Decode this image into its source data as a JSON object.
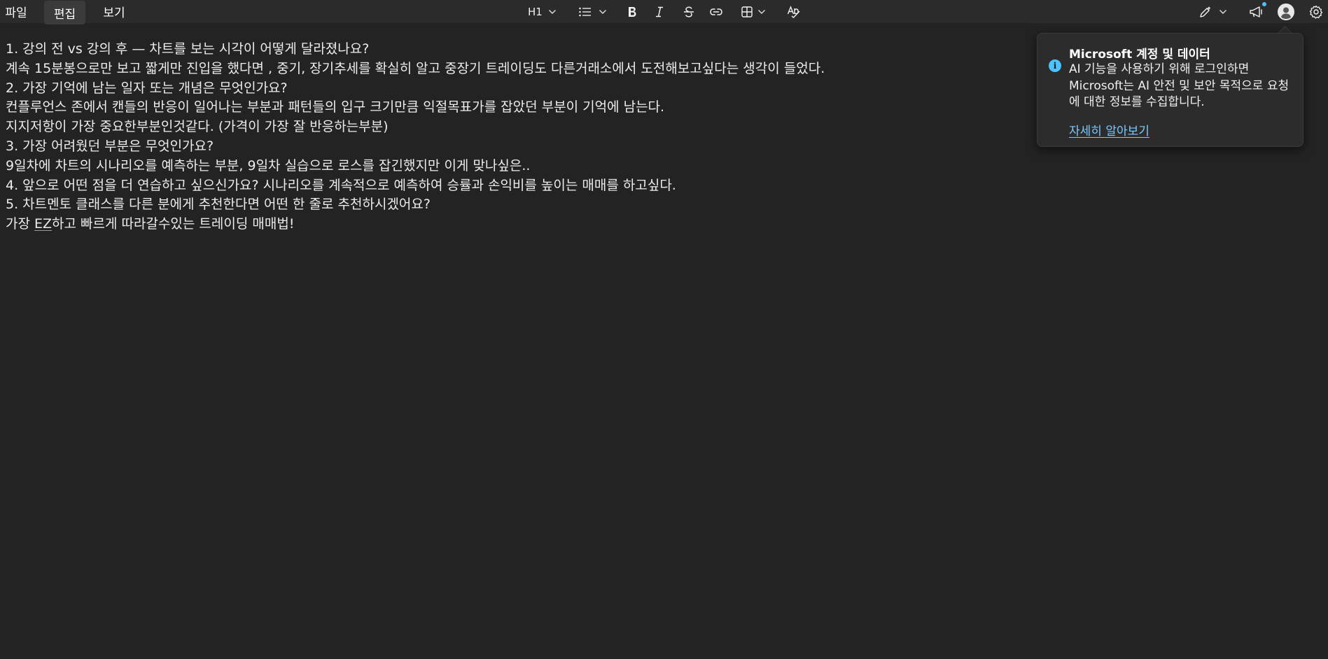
{
  "menu": {
    "file": "파일",
    "edit": "편집",
    "view": "보기"
  },
  "toolbar": {
    "heading_label": "H1",
    "icons": [
      "list-icon",
      "bold-icon",
      "italic-icon",
      "strikethrough-icon",
      "link-icon",
      "table-icon",
      "spellcheck-icon",
      "copilot-pen-icon",
      "announcement-icon",
      "account-avatar-icon",
      "settings-icon"
    ]
  },
  "document": {
    "lines": [
      "1. 강의 전 vs 강의 후 — 차트를 보는 시각이 어떻게 달라졌나요?",
      "계속 15분봉으로만 보고 짧게만 진입을 했다면 , 중기, 장기추세를 확실히 알고 중장기 트레이딩도 다른거래소에서 도전해보고싶다는 생각이 들었다.",
      "2. 가장 기억에 남는 일자 또는 개념은 무엇인가요?",
      "컨플루언스 존에서 캔들의 반응이 일어나는 부분과 패턴들의 입구 크기만큼 익절목표가를 잡았던 부분이 기억에 남는다.",
      "지지저항이 가장 중요한부분인것같다. (가격이 가장 잘 반응하는부분)",
      "3. 가장 어려웠던 부분은 무엇인가요?",
      "9일차에 차트의 시나리오를 예측하는 부분, 9일차 실습으로 로스를 잡긴했지만 이게 맞나싶은..",
      "4. 앞으로 어떤 점을 더 연습하고 싶으신가요? 시나리오를 계속적으로 예측하여 승률과 손익비를 높이는 매매를 하고싶다.",
      "5. 차트멘토 클래스를 다른 분에게 추천한다면 어떤 한 줄로 추천하시겠어요?"
    ],
    "last_line_prefix": "가장 ",
    "last_line_ez": "EZ",
    "last_line_suffix": "하고 빠르게 따라갈수있는 트레이딩 매매법!"
  },
  "popup": {
    "title": "Microsoft 계정 및 데이터",
    "body": "AI 기능을 사용하기 위해 로그인하면 Microsoft는 AI 안전 및 보안 목적으로 요청에 대한 정보를 수집합니다.",
    "link": "자세히 알아보기"
  },
  "colors": {
    "background": "#232323",
    "toolbar": "#2b2b2b",
    "accent": "#4cc2ff",
    "link": "#7ac9ff"
  }
}
